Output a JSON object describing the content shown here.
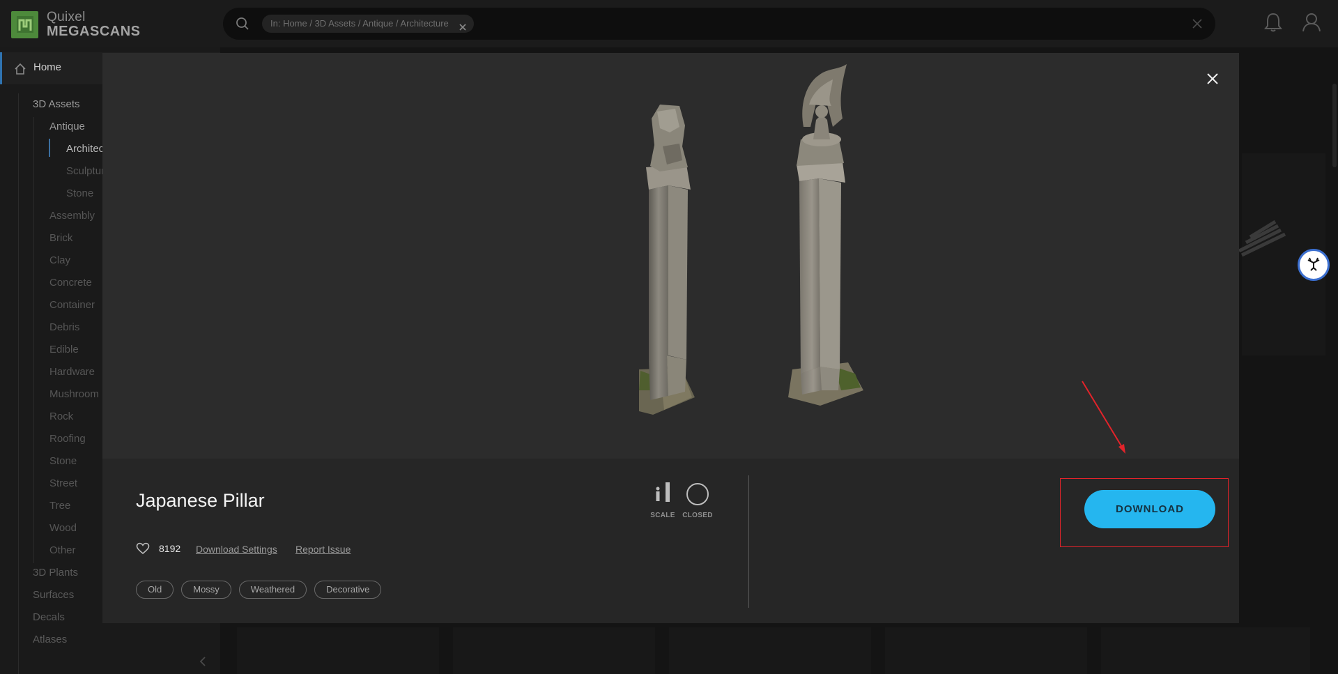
{
  "app": {
    "brand_line1": "Quixel",
    "brand_line2": "MEGASCANS"
  },
  "search": {
    "chip_label": "In: Home / 3D Assets / Antique / Architecture",
    "placeholder": ""
  },
  "sidebar": {
    "home_label": "Home",
    "items": [
      {
        "label": "3D Assets"
      },
      {
        "label": "Antique"
      },
      {
        "label": "Architecture"
      },
      {
        "label": "Sculpture"
      },
      {
        "label": "Stone"
      },
      {
        "label": "Assembly"
      },
      {
        "label": "Brick"
      },
      {
        "label": "Clay"
      },
      {
        "label": "Concrete"
      },
      {
        "label": "Container"
      },
      {
        "label": "Debris"
      },
      {
        "label": "Edible"
      },
      {
        "label": "Hardware"
      },
      {
        "label": "Mushroom"
      },
      {
        "label": "Rock"
      },
      {
        "label": "Roofing"
      },
      {
        "label": "Stone"
      },
      {
        "label": "Street"
      },
      {
        "label": "Tree"
      },
      {
        "label": "Wood"
      },
      {
        "label": "Other"
      },
      {
        "label": "3D Plants"
      },
      {
        "label": "Surfaces"
      },
      {
        "label": "Decals"
      },
      {
        "label": "Atlases"
      }
    ]
  },
  "asset": {
    "title": "Japanese Pillar",
    "likes": "8192",
    "download_settings_label": "Download Settings",
    "report_issue_label": "Report Issue",
    "tags": [
      "Old",
      "Mossy",
      "Weathered",
      "Decorative"
    ],
    "scale_label": "SCALE",
    "closed_label": "CLOSED",
    "download_label": "DOWNLOAD"
  },
  "colors": {
    "accent": "#25b6ef",
    "highlight": "#e3232a",
    "brand_green": "#4d8a3b"
  },
  "icons": {
    "search": "search-icon",
    "bell": "bell-icon",
    "user": "user-icon",
    "home": "home-icon",
    "close": "close-icon",
    "heart": "heart-icon"
  }
}
